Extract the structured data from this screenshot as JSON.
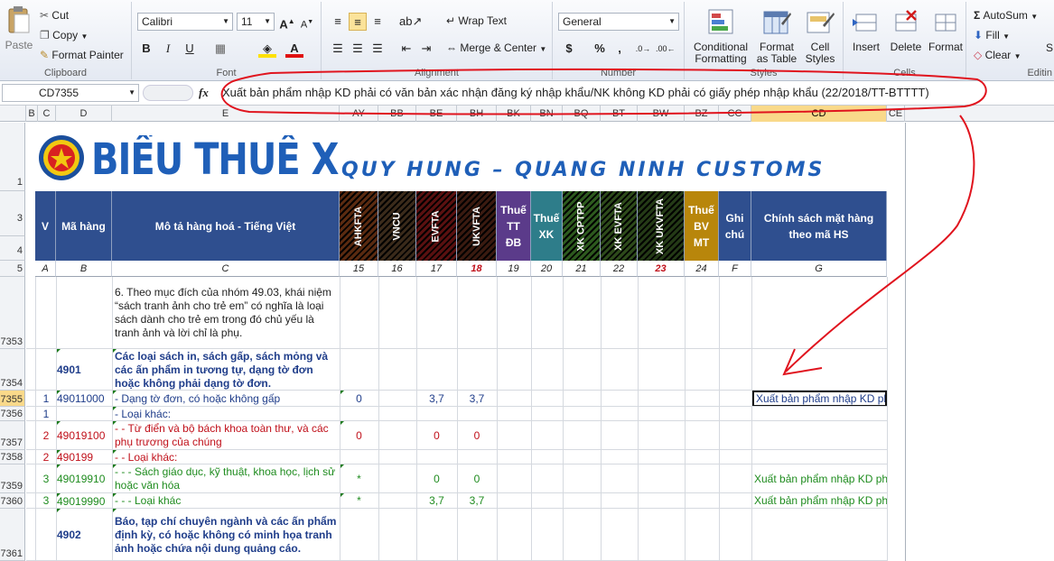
{
  "ribbon": {
    "clipboard": {
      "paste": "Paste",
      "cut": "Cut",
      "copy": "Copy",
      "format_painter": "Format Painter",
      "label": "Clipboard"
    },
    "font": {
      "name": "Calibri",
      "size": "11",
      "label": "Font",
      "bold": "B",
      "italic": "I",
      "underline": "U"
    },
    "alignment": {
      "wrap_text": "Wrap Text",
      "merge_center": "Merge & Center",
      "label": "Alignment"
    },
    "number": {
      "format": "General",
      "currency": "$",
      "percent": "%",
      "comma": ",",
      "label": "Number"
    },
    "styles": {
      "conditional_1": "Conditional",
      "conditional_2": "Formatting",
      "format_table_1": "Format",
      "format_table_2": "as Table",
      "cell_styles_1": "Cell",
      "cell_styles_2": "Styles",
      "label": "Styles"
    },
    "cells": {
      "insert": "Insert",
      "delete": "Delete",
      "format": "Format",
      "label": "Cells"
    },
    "editing": {
      "autosum": "AutoSum",
      "fill": "Fill",
      "clear": "Clear",
      "label": "Editin",
      "sort": "S"
    }
  },
  "formula_bar": {
    "name_box": "CD7355",
    "fx": "fx",
    "content": "Xuất bản phẩm nhập KD phải có văn bản xác nhận đăng ký nhập khẩu/NK không KD phải có giấy phép nhập khẩu (22/2018/TT-BTTTT)"
  },
  "columns": [
    "B",
    "C",
    "D",
    "E",
    "AY",
    "BB",
    "BE",
    "BH",
    "BK",
    "BN",
    "BQ",
    "BT",
    "BW",
    "BZ",
    "CC",
    "CD",
    "CE"
  ],
  "banner": {
    "title": "BIỂU THUẾ XN",
    "subtitle": "QUY HUNG – QUANG NINH CUSTOMS"
  },
  "header": {
    "v": "V",
    "ma_hang": "Mã hàng",
    "mo_ta": "Mô tả hàng hoá - Tiếng Việt",
    "ahkfta": "AHKFTA",
    "vncu": "VNCU",
    "evfta": "EVFTA",
    "ukvfta": "UKVFTA",
    "thue_tt_1": "Thuế",
    "thue_tt_2": "TT",
    "thue_tt_3": "ĐB",
    "thue_xk_1": "Thuế",
    "thue_xk_2": "XK",
    "xk_cptpp": "XK CPTPP",
    "xk_evfta": "XK EVFTA",
    "xk_ukvfta": "XK UKVFTA",
    "thue_bvmt_1": "Thuế",
    "thue_bvmt_2": "BV",
    "thue_bvmt_3": "MT",
    "ghi_chu_1": "Ghi",
    "ghi_chu_2": "chú",
    "chinh_sach_1": "Chính sách mặt hàng",
    "chinh_sach_2": "theo mã HS"
  },
  "col_numbers": [
    "A",
    "B",
    "C",
    "15",
    "16",
    "17",
    "18",
    "19",
    "20",
    "21",
    "22",
    "23",
    "24",
    "F",
    "G"
  ],
  "row_numbers": {
    "r1": "1",
    "r3": "3",
    "r4": "4",
    "r5": "5"
  },
  "rows": [
    {
      "num": "7353",
      "v": "",
      "code": "",
      "desc": "6. Theo mục đích của nhóm 49.03, khái niệm “sách tranh ảnh cho trẻ em” có nghĩa là loại sách dành cho trẻ em trong đó chủ yếu là tranh ảnh và lời chỉ là phụ.",
      "ay": "",
      "be": "",
      "bh": "",
      "cd": ""
    },
    {
      "num": "7354",
      "v": "",
      "code": "4901",
      "desc": "Các loại sách in, sách gấp, sách mỏng và các ấn phẩm in tương tự, dạng tờ đơn hoặc không phải dạng tờ đơn.",
      "ay": "",
      "be": "",
      "bh": "",
      "cd": ""
    },
    {
      "num": "7355",
      "v": "1",
      "code": "49011000",
      "desc": "- Dạng tờ đơn, có hoặc không gấp",
      "ay": "0",
      "be": "3,7",
      "bh": "3,7",
      "cd": "Xuất bản phẩm nhập KD ph"
    },
    {
      "num": "7356",
      "v": "1",
      "code": "",
      "desc": "- Loại khác:",
      "ay": "",
      "be": "",
      "bh": "",
      "cd": ""
    },
    {
      "num": "7357",
      "v": "2",
      "code": "49019100",
      "desc": "- - Từ điển và bộ bách khoa toàn thư, và các phụ trương của chúng",
      "ay": "0",
      "be": "0",
      "bh": "0",
      "cd": ""
    },
    {
      "num": "7358",
      "v": "2",
      "code": "490199",
      "desc": "- - Loại khác:",
      "ay": "",
      "be": "",
      "bh": "",
      "cd": ""
    },
    {
      "num": "7359",
      "v": "3",
      "code": "49019910",
      "desc": "- - - Sách giáo dục, kỹ thuật, khoa học, lịch sử hoặc văn hóa",
      "ay": "*",
      "be": "0",
      "bh": "0",
      "cd": "Xuất bản phẩm nhập KD ph"
    },
    {
      "num": "7360",
      "v": "3",
      "code": "49019990",
      "desc": "- - - Loại khác",
      "ay": "*",
      "be": "3,7",
      "bh": "3,7",
      "cd": "Xuất bản phẩm nhập KD ph"
    },
    {
      "num": "7361",
      "v": "",
      "code": "4902",
      "desc": "Báo, tạp chí chuyên ngành và các ấn phẩm định kỳ, có hoặc không có minh họa tranh ảnh hoặc chứa nội dung quảng cáo.",
      "ay": "",
      "be": "",
      "bh": "",
      "cd": ""
    }
  ],
  "colors": {
    "header_blue": "#2f4f8f",
    "annotation": "#e0141e",
    "dark_blue": "#1f3d8a",
    "green": "#1f8c1f",
    "red": "#c0101a",
    "selected": "#f9d98a"
  }
}
